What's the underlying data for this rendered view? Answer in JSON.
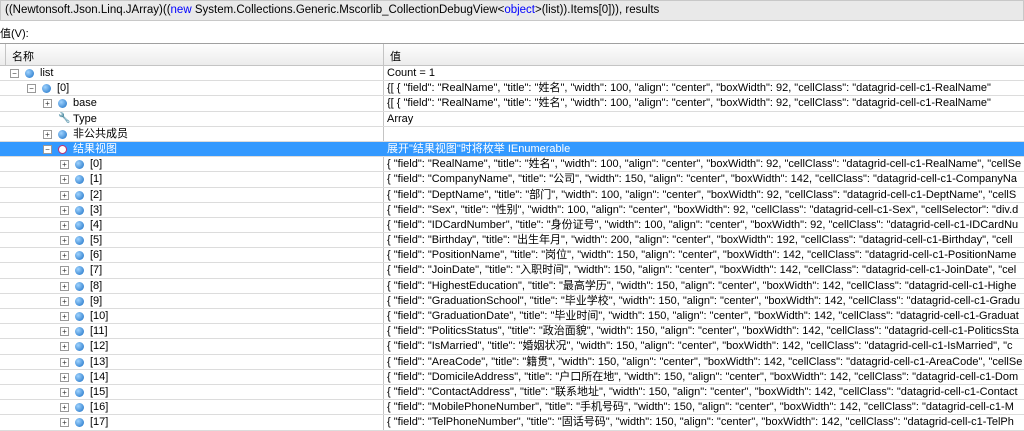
{
  "expression": {
    "prefix": "((Newtonsoft.Json.Linq.JArray)((",
    "kw1": "new",
    "mid": " System.Collections.Generic.Mscorlib_CollectionDebugView<",
    "kw2": "object",
    "suffix": ">(list)).Items[0])), results"
  },
  "value_label": "值(V):",
  "columns": {
    "name": "名称",
    "value": "值"
  },
  "rows": [
    {
      "name": "list",
      "value": "Count = 1",
      "level": 0,
      "toggle": "minus",
      "icon": "obj"
    },
    {
      "name": "[0]",
      "value": "{[ {    \"field\": \"RealName\",    \"title\": \"姓名\",    \"width\": 100,    \"align\": \"center\",    \"boxWidth\": 92,    \"cellClass\": \"datagrid-cell-c1-RealName\"",
      "level": 1,
      "toggle": "minus",
      "icon": "obj"
    },
    {
      "name": "base",
      "value": "{[ {    \"field\": \"RealName\",    \"title\": \"姓名\",    \"width\": 100,    \"align\": \"center\",    \"boxWidth\": 92,    \"cellClass\": \"datagrid-cell-c1-RealName\"",
      "level": 2,
      "toggle": "plus",
      "icon": "obj"
    },
    {
      "name": "Type",
      "value": "Array",
      "level": 2,
      "toggle": "",
      "icon": "wrench"
    },
    {
      "name": "非公共成员",
      "value": "",
      "level": 2,
      "toggle": "plus",
      "icon": "obj"
    },
    {
      "name": "结果视图",
      "value": "展开\"结果视图\"时将枚举 IEnumerable",
      "level": 2,
      "toggle": "minus",
      "icon": "view",
      "selected": true
    },
    {
      "name": "[0]",
      "value": "{  \"field\": \"RealName\",  \"title\": \"姓名\",  \"width\": 100,  \"align\": \"center\",  \"boxWidth\": 92,  \"cellClass\": \"datagrid-cell-c1-RealName\",  \"cellSe",
      "level": 3,
      "toggle": "plus",
      "icon": "obj"
    },
    {
      "name": "[1]",
      "value": "{  \"field\": \"CompanyName\",  \"title\": \"公司\",  \"width\": 150,  \"align\": \"center\",  \"boxWidth\": 142,  \"cellClass\": \"datagrid-cell-c1-CompanyNa",
      "level": 3,
      "toggle": "plus",
      "icon": "obj"
    },
    {
      "name": "[2]",
      "value": "{  \"field\": \"DeptName\",  \"title\": \"部门\",  \"width\": 100,  \"align\": \"center\",  \"boxWidth\": 92,  \"cellClass\": \"datagrid-cell-c1-DeptName\",  \"cellS",
      "level": 3,
      "toggle": "plus",
      "icon": "obj"
    },
    {
      "name": "[3]",
      "value": "{  \"field\": \"Sex\",  \"title\": \"性别\",  \"width\": 100,  \"align\": \"center\",  \"boxWidth\": 92,  \"cellClass\": \"datagrid-cell-c1-Sex\",  \"cellSelector\": \"div.d",
      "level": 3,
      "toggle": "plus",
      "icon": "obj"
    },
    {
      "name": "[4]",
      "value": "{  \"field\": \"IDCardNumber\",  \"title\": \"身份证号\",  \"width\": 100,  \"align\": \"center\",  \"boxWidth\": 92,  \"cellClass\": \"datagrid-cell-c1-IDCardNu",
      "level": 3,
      "toggle": "plus",
      "icon": "obj"
    },
    {
      "name": "[5]",
      "value": "{  \"field\": \"Birthday\",  \"title\": \"出生年月\",  \"width\": 200,  \"align\": \"center\",  \"boxWidth\": 192,  \"cellClass\": \"datagrid-cell-c1-Birthday\",  \"cell",
      "level": 3,
      "toggle": "plus",
      "icon": "obj"
    },
    {
      "name": "[6]",
      "value": "{  \"field\": \"PositionName\",  \"title\": \"岗位\",  \"width\": 150,  \"align\": \"center\",  \"boxWidth\": 142,  \"cellClass\": \"datagrid-cell-c1-PositionName",
      "level": 3,
      "toggle": "plus",
      "icon": "obj"
    },
    {
      "name": "[7]",
      "value": "{  \"field\": \"JoinDate\",  \"title\": \"入职时间\",  \"width\": 150,  \"align\": \"center\",  \"boxWidth\": 142,  \"cellClass\": \"datagrid-cell-c1-JoinDate\",  \"cel",
      "level": 3,
      "toggle": "plus",
      "icon": "obj"
    },
    {
      "name": "[8]",
      "value": "{  \"field\": \"HighestEducation\",  \"title\": \"最高学历\",  \"width\": 150,  \"align\": \"center\",  \"boxWidth\": 142,  \"cellClass\": \"datagrid-cell-c1-Highe",
      "level": 3,
      "toggle": "plus",
      "icon": "obj"
    },
    {
      "name": "[9]",
      "value": "{  \"field\": \"GraduationSchool\",  \"title\": \"毕业学校\",  \"width\": 150,  \"align\": \"center\",  \"boxWidth\": 142,  \"cellClass\": \"datagrid-cell-c1-Gradu",
      "level": 3,
      "toggle": "plus",
      "icon": "obj"
    },
    {
      "name": "[10]",
      "value": "{  \"field\": \"GraduationDate\",  \"title\": \"毕业时间\",  \"width\": 150,  \"align\": \"center\",  \"boxWidth\": 142,  \"cellClass\": \"datagrid-cell-c1-Graduat",
      "level": 3,
      "toggle": "plus",
      "icon": "obj"
    },
    {
      "name": "[11]",
      "value": "{  \"field\": \"PoliticsStatus\",  \"title\": \"政治面貌\",  \"width\": 150,  \"align\": \"center\",  \"boxWidth\": 142,  \"cellClass\": \"datagrid-cell-c1-PoliticsSta",
      "level": 3,
      "toggle": "plus",
      "icon": "obj"
    },
    {
      "name": "[12]",
      "value": "{  \"field\": \"IsMarried\",  \"title\": \"婚姻状况\",  \"width\": 150,  \"align\": \"center\",  \"boxWidth\": 142,  \"cellClass\": \"datagrid-cell-c1-IsMarried\",  \"c",
      "level": 3,
      "toggle": "plus",
      "icon": "obj"
    },
    {
      "name": "[13]",
      "value": "{  \"field\": \"AreaCode\",  \"title\": \"籍贯\",  \"width\": 150,  \"align\": \"center\",  \"boxWidth\": 142,  \"cellClass\": \"datagrid-cell-c1-AreaCode\",  \"cellSe",
      "level": 3,
      "toggle": "plus",
      "icon": "obj"
    },
    {
      "name": "[14]",
      "value": "{  \"field\": \"DomicileAddress\",  \"title\": \"户口所在地\",  \"width\": 150,  \"align\": \"center\",  \"boxWidth\": 142,  \"cellClass\": \"datagrid-cell-c1-Dom",
      "level": 3,
      "toggle": "plus",
      "icon": "obj"
    },
    {
      "name": "[15]",
      "value": "{  \"field\": \"ContactAddress\",  \"title\": \"联系地址\",  \"width\": 150,  \"align\": \"center\",  \"boxWidth\": 142,  \"cellClass\": \"datagrid-cell-c1-Contact",
      "level": 3,
      "toggle": "plus",
      "icon": "obj"
    },
    {
      "name": "[16]",
      "value": "{  \"field\": \"MobilePhoneNumber\",  \"title\": \"手机号码\",  \"width\": 150,  \"align\": \"center\",  \"boxWidth\": 142,  \"cellClass\": \"datagrid-cell-c1-M",
      "level": 3,
      "toggle": "plus",
      "icon": "obj"
    },
    {
      "name": "[17]",
      "value": "{  \"field\": \"TelPhoneNumber\",  \"title\": \"固话号码\",  \"width\": 150,  \"align\": \"center\",  \"boxWidth\": 142,  \"cellClass\": \"datagrid-cell-c1-TelPh",
      "level": 3,
      "toggle": "plus",
      "icon": "obj"
    }
  ]
}
